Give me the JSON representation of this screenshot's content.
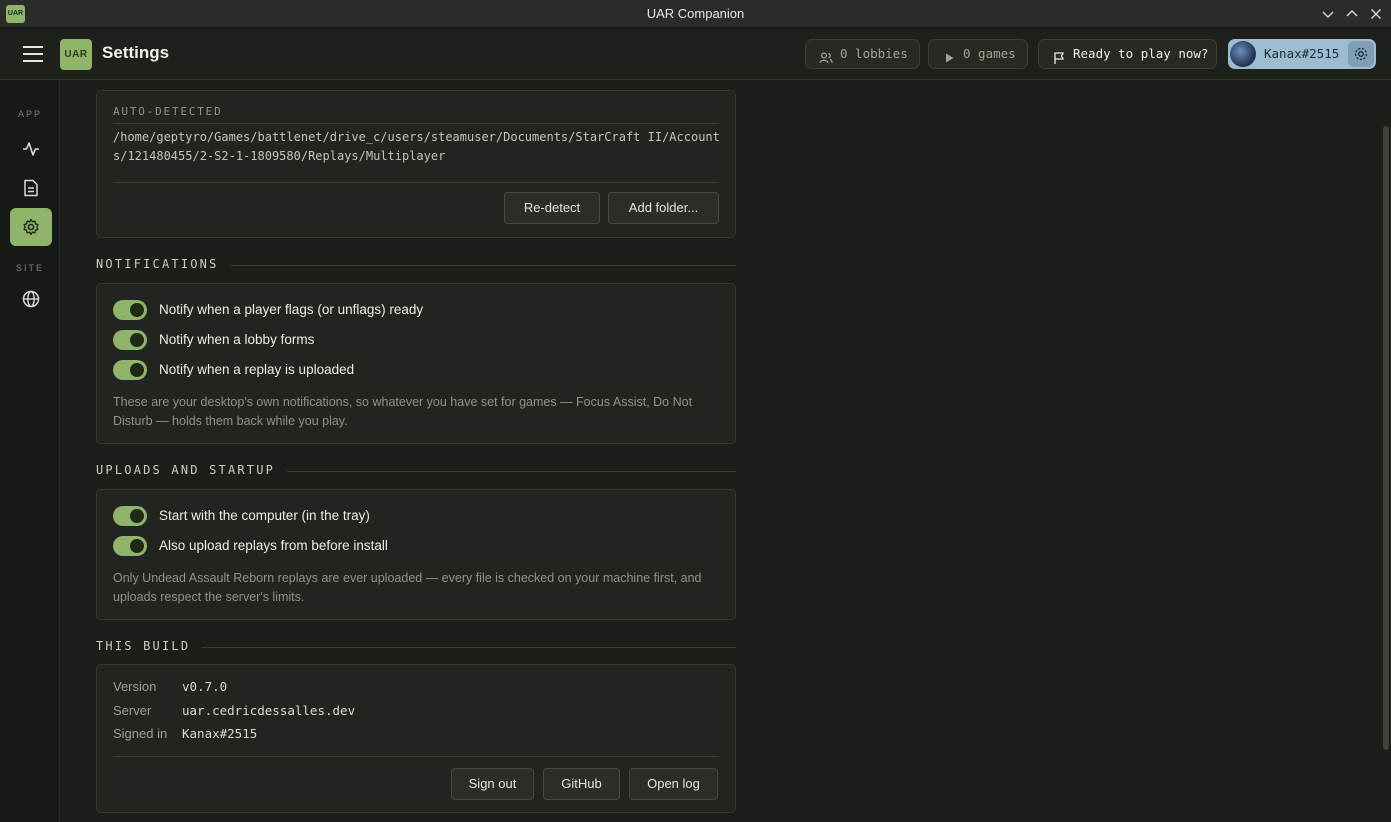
{
  "window": {
    "app_icon_text": "UAR",
    "title": "UAR Companion"
  },
  "header": {
    "brand": "UAR",
    "page_title": "Settings",
    "lobbies": "0 lobbies",
    "games": "0 games",
    "ready": "Ready to play now?",
    "username": "Kanax#2515"
  },
  "sidebar": {
    "app_label": "APP",
    "site_label": "SITE",
    "items": [
      {
        "icon": "activity-icon"
      },
      {
        "icon": "document-icon"
      },
      {
        "icon": "gear-icon",
        "active": true
      },
      {
        "icon": "globe-icon"
      }
    ]
  },
  "replay_folders": {
    "heading": "AUTO-DETECTED",
    "path": "/home/geptyro/Games/battlenet/drive_c/users/steamuser/Documents/StarCraft II/Accounts/121480455/2-S2-1-1809580/Replays/Multiplayer",
    "redetect_label": "Re-detect",
    "add_folder_label": "Add folder..."
  },
  "notifications": {
    "heading": "NOTIFICATIONS",
    "toggles": [
      {
        "label": "Notify when a player flags (or unflags) ready",
        "on": true
      },
      {
        "label": "Notify when a lobby forms",
        "on": true
      },
      {
        "label": "Notify when a replay is uploaded",
        "on": true
      }
    ],
    "note": "These are your desktop's own notifications, so whatever you have set for games — Focus Assist, Do Not Disturb — holds them back while you play."
  },
  "uploads": {
    "heading": "UPLOADS AND STARTUP",
    "toggles": [
      {
        "label": "Start with the computer (in the tray)",
        "on": true
      },
      {
        "label": "Also upload replays from before install",
        "on": true
      }
    ],
    "note": "Only Undead Assault Reborn replays are ever uploaded — every file is checked on your machine first, and uploads respect the server's limits."
  },
  "build": {
    "heading": "THIS BUILD",
    "version_key": "Version",
    "version_value": "v0.7.0",
    "server_key": "Server",
    "server_value": "uar.cedricdessalles.dev",
    "signed_key": "Signed in",
    "signed_value": "Kanax#2515",
    "sign_out_label": "Sign out",
    "github_label": "GitHub",
    "open_log_label": "Open log"
  },
  "colors": {
    "accent": "#8fb56b",
    "background": "#1b1e19",
    "card": "#22251f"
  }
}
